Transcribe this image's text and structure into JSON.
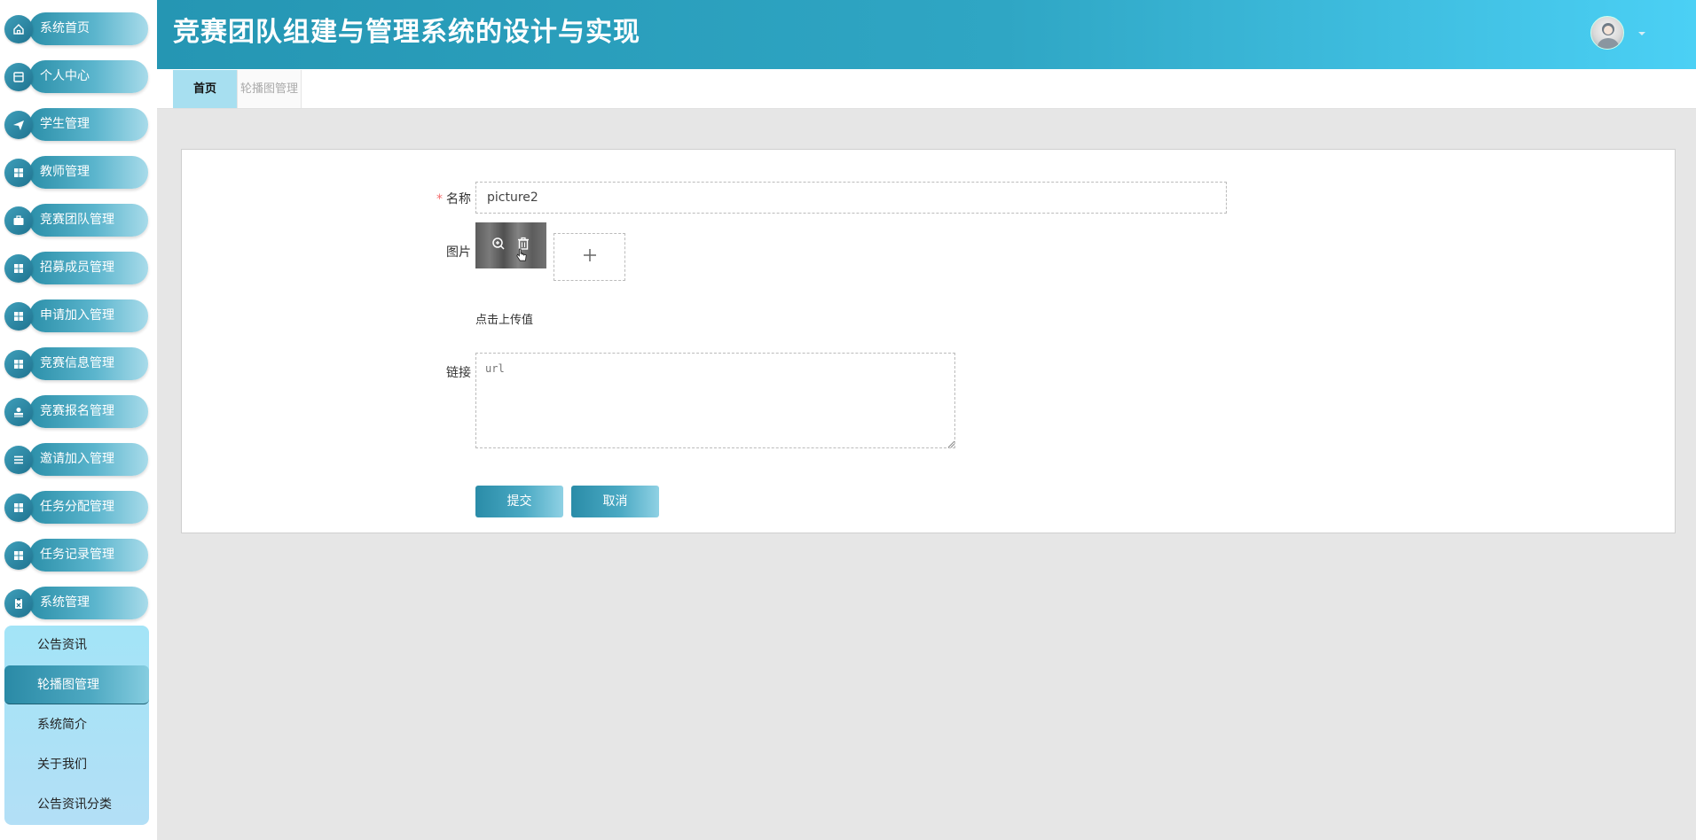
{
  "header": {
    "title": "竞赛团队组建与管理系统的设计与实现"
  },
  "sidebar": {
    "items": [
      {
        "label": "系统首页",
        "icon": "home-icon"
      },
      {
        "label": "个人中心",
        "icon": "document-icon"
      },
      {
        "label": "学生管理",
        "icon": "send-icon"
      },
      {
        "label": "教师管理",
        "icon": "grid-icon"
      },
      {
        "label": "竞赛团队管理",
        "icon": "briefcase-icon"
      },
      {
        "label": "招募成员管理",
        "icon": "grid-icon"
      },
      {
        "label": "申请加入管理",
        "icon": "grid-icon"
      },
      {
        "label": "竞赛信息管理",
        "icon": "grid-icon"
      },
      {
        "label": "竞赛报名管理",
        "icon": "stamp-icon"
      },
      {
        "label": "邀请加入管理",
        "icon": "list-icon"
      },
      {
        "label": "任务分配管理",
        "icon": "grid-icon"
      },
      {
        "label": "任务记录管理",
        "icon": "grid-icon"
      },
      {
        "label": "系统管理",
        "icon": "clipboard-icon"
      }
    ],
    "submenu": [
      {
        "label": "公告资讯"
      },
      {
        "label": "轮播图管理",
        "active": true
      },
      {
        "label": "系统简介"
      },
      {
        "label": "关于我们"
      },
      {
        "label": "公告资讯分类"
      }
    ]
  },
  "tabs": {
    "home": "首页",
    "carousel": "轮播图管理"
  },
  "form": {
    "required_mark": "*",
    "name_label": "名称",
    "name_value": "picture2",
    "image_label": "图片",
    "upload_hint": "点击上传值",
    "link_label": "链接",
    "link_placeholder": "url",
    "submit_label": "提交",
    "cancel_label": "取消"
  },
  "colors": {
    "header_start": "#2596b3",
    "header_end": "#4bd0f5",
    "menu_pill": "#5bb5cd",
    "submenu_bg": "#a3e4f7",
    "required": "#f56c6c"
  }
}
